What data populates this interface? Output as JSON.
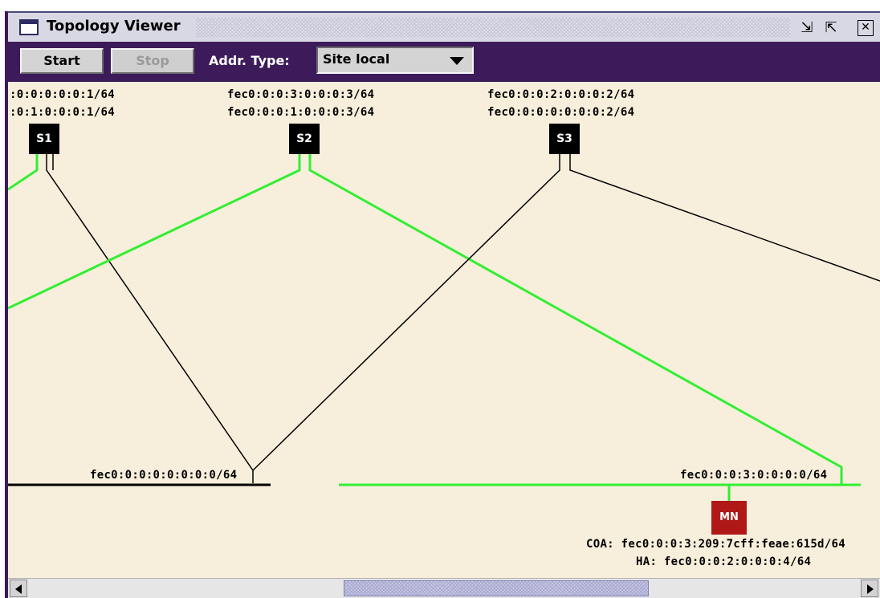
{
  "window": {
    "title": "Topology Viewer",
    "icons": [
      "window-icon",
      "minimize-icon",
      "maximize-icon",
      "close-icon"
    ],
    "minimize_glyph": "⇲",
    "maximize_glyph": "⇱",
    "close_glyph": "✕"
  },
  "toolbar": {
    "start_label": "Start",
    "stop_label": "Stop",
    "addr_type_label": "Addr. Type:",
    "addr_type_value": "Site local"
  },
  "topology": {
    "nodes": {
      "s1": {
        "label": "S1",
        "addr1": ":0:0:0:0:0:1/64",
        "addr2": ":0:1:0:0:0:1/64"
      },
      "s2": {
        "label": "S2",
        "addr1": "fec0:0:0:3:0:0:0:3/64",
        "addr2": "fec0:0:0:1:0:0:0:3/64"
      },
      "s3": {
        "label": "S3",
        "addr1": "fec0:0:0:2:0:0:0:2/64",
        "addr2": "fec0:0:0:0:0:0:0:2/64"
      },
      "mn": {
        "label": "MN",
        "coa": "COA: fec0:0:0:3:209:7cff:feae:615d/64",
        "ha": "HA: fec0:0:0:2:0:0:0:4/64"
      }
    },
    "networks": {
      "net0": "fec0:0:0:0:0:0:0:0/64",
      "net3": "fec0:0:0:3:0:0:0:0/64"
    },
    "colors": {
      "background": "#f7efdb",
      "active_link": "#33ee33",
      "inactive_link": "#000000",
      "router": "#000000",
      "mobile_node": "#b01818"
    }
  }
}
